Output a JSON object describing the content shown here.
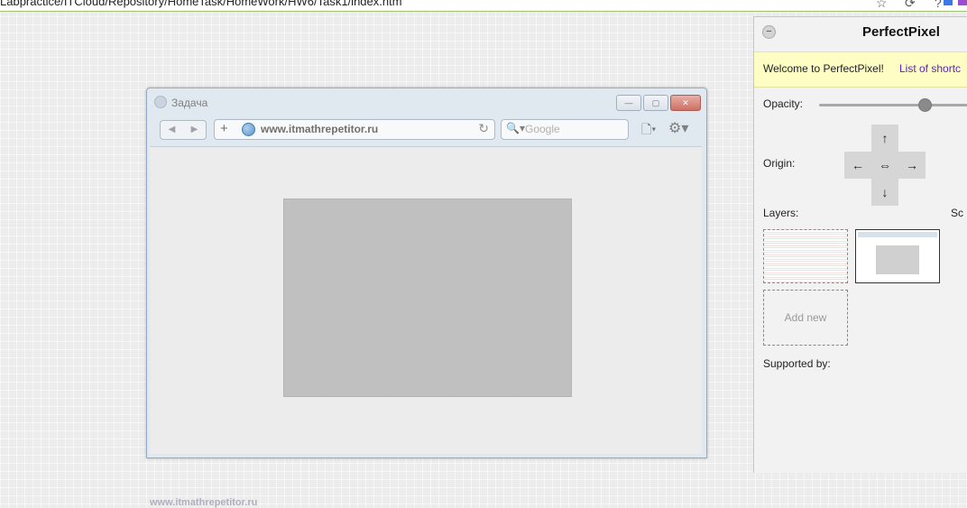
{
  "chrome": {
    "url": "Labpractice/ITCloud/Repository/HomeTask/HomeWork/HW6/Task1/index.htm",
    "star_icon": "☆",
    "extension_icon": "⟳",
    "help_icon": "?",
    "colors": {
      "accent": "#3b78e7"
    }
  },
  "mock_browser": {
    "title": "Задача",
    "min_glyph": "—",
    "max_glyph": "▢",
    "close_glyph": "✕",
    "back_glyph": "◀",
    "forward_glyph": "▶",
    "plus_glyph": "+",
    "url": "www.itmathrepetitor.ru",
    "reload_glyph": "↻",
    "search_glyph": "🔍▾",
    "search_placeholder": "Google",
    "page_glyph": "🗋▾",
    "gear_glyph": "⚙▾",
    "footer": "www.itmathrepetitor.ru"
  },
  "panel": {
    "collapse_glyph": "−",
    "title": "PerfectPixel",
    "welcome_text": "Welcome to PerfectPixel!",
    "welcome_link": "List of shortc",
    "opacity_label": "Opacity:",
    "opacity_value": 0.7,
    "origin_label": "Origin:",
    "arrows": {
      "up": "↑",
      "left": "←",
      "center": "⇔",
      "right": "→",
      "down": "↓"
    },
    "layers_label": "Layers:",
    "scale_label": "Sc",
    "add_new": "Add new",
    "supported_by": "Supported by:"
  }
}
